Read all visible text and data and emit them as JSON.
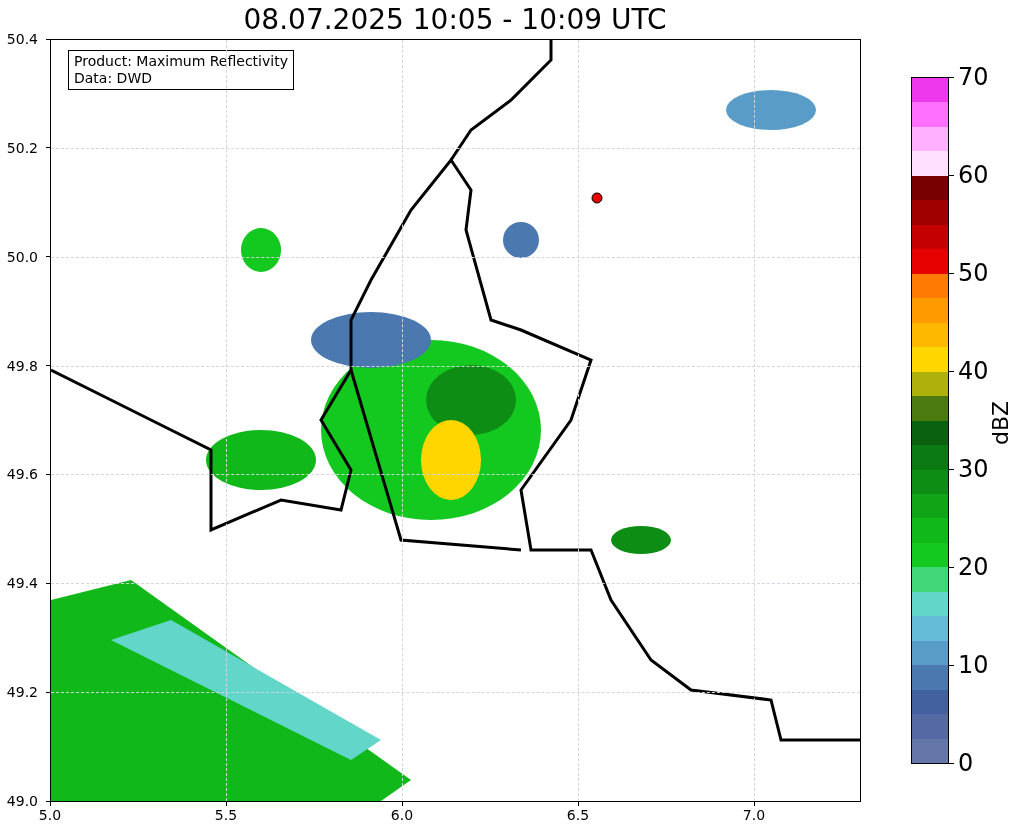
{
  "title": "08.07.2025 10:05 - 10:09 UTC",
  "annotation": [
    "Product: Maximum Reflectivity",
    "Data: DWD"
  ],
  "y_ticks": [
    "50.4",
    "50.2",
    "50.0",
    "49.8",
    "49.6",
    "49.4",
    "49.2",
    "49.0"
  ],
  "x_ticks": [
    "5.0",
    "5.5",
    "6.0",
    "6.5",
    "7.0"
  ],
  "colorbar": {
    "label": "dBZ",
    "ticks": [
      "70",
      "60",
      "50",
      "40",
      "30",
      "20",
      "10",
      "0"
    ],
    "segments": [
      {
        "color": "#ee38ee"
      },
      {
        "color": "#ff70ff"
      },
      {
        "color": "#ffb0ff"
      },
      {
        "color": "#ffe0ff"
      },
      {
        "color": "#780000"
      },
      {
        "color": "#a00000"
      },
      {
        "color": "#c40000"
      },
      {
        "color": "#e60000"
      },
      {
        "color": "#ff7a00"
      },
      {
        "color": "#ff9a00"
      },
      {
        "color": "#ffb800"
      },
      {
        "color": "#ffd600"
      },
      {
        "color": "#aeb10a"
      },
      {
        "color": "#4a7a10"
      },
      {
        "color": "#0a6210"
      },
      {
        "color": "#0c7a12"
      },
      {
        "color": "#0e8d14"
      },
      {
        "color": "#10a516"
      },
      {
        "color": "#11b81a"
      },
      {
        "color": "#13c81f"
      },
      {
        "color": "#3fd777"
      },
      {
        "color": "#62d6c8"
      },
      {
        "color": "#64bcd8"
      },
      {
        "color": "#5a9cc8"
      },
      {
        "color": "#4c78b0"
      },
      {
        "color": "#43609f"
      },
      {
        "color": "#5569a3"
      },
      {
        "color": "#6577a8"
      }
    ]
  }
}
